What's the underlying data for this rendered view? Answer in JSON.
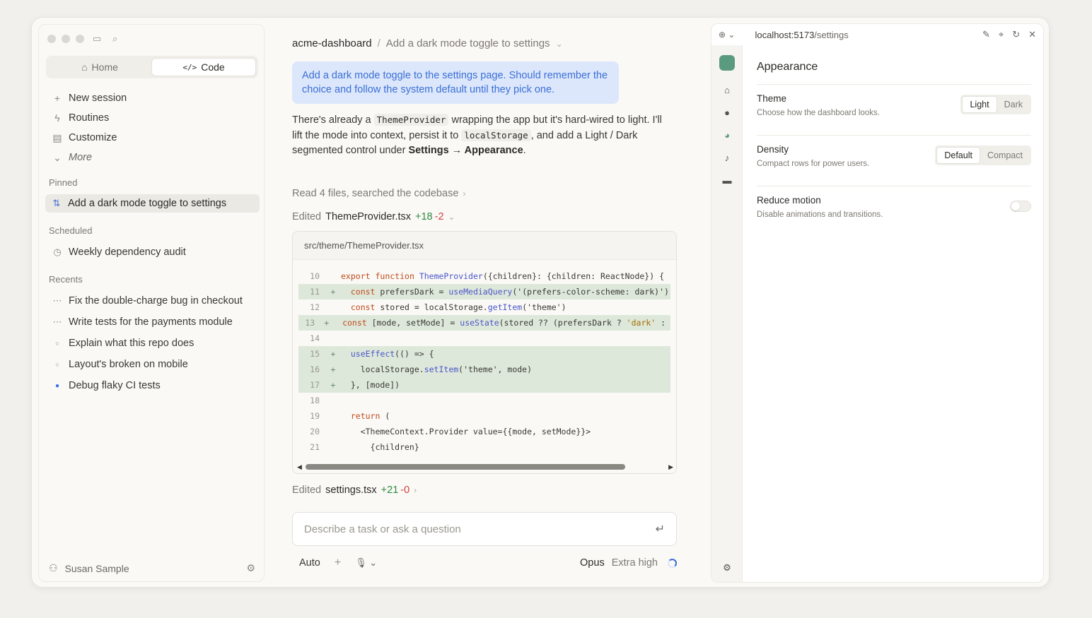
{
  "sidebar": {
    "segment": {
      "home_label": "Home",
      "code_label": "Code"
    },
    "nav": [
      {
        "label": "New session",
        "icon": "plus-icon"
      },
      {
        "label": "Routines",
        "icon": "lightning-icon"
      },
      {
        "label": "Customize",
        "icon": "box-icon"
      },
      {
        "label": "More",
        "icon": "chevron-down-icon"
      }
    ],
    "pinned_label": "Pinned",
    "pinned_item": "Add a dark mode toggle to settings",
    "scheduled_label": "Scheduled",
    "scheduled_item": "Weekly dependency audit",
    "recents_label": "Recents",
    "recents": [
      {
        "label": "Fix the double-charge bug in checkout"
      },
      {
        "label": "Write tests for the payments module"
      },
      {
        "label": "Explain what this repo does"
      },
      {
        "label": "Layout's broken on mobile"
      },
      {
        "label": "Debug flaky CI tests"
      }
    ],
    "user_name": "Susan Sample"
  },
  "main": {
    "repo": "acme-dashboard",
    "breadcrumb_sep": "/",
    "session_title": "Add a dark mode toggle to settings",
    "user_message": "Add a dark mode toggle to the settings page. Should remember the choice and follow the system default until they pick one.",
    "reply": {
      "p1": "There's already a ",
      "c1": "ThemeProvider",
      "p2": " wrapping the app but it's hard-wired to light. I'll lift the mode into context, persist it to ",
      "c2": "localStorage",
      "p3": ", and add a Light / Dark segmented control under ",
      "b1": "Settings → Appearance",
      "p4": "."
    },
    "activity_read": "Read 4 files, searched the codebase",
    "edit1": {
      "prefix": "Edited",
      "file": "ThemeProvider.tsx",
      "add": "+18",
      "del": "-2"
    },
    "code_file_path": "src/theme/ThemeProvider.tsx",
    "edit2": {
      "prefix": "Edited",
      "file": "settings.tsx",
      "add": "+21",
      "del": "-0"
    },
    "input_placeholder": "Describe a task or ask a question",
    "bottom": {
      "mode": "Auto",
      "model": "Opus",
      "effort": "Extra high"
    }
  },
  "browser": {
    "url_host": "localhost:5173",
    "url_path": "/settings",
    "heading": "Appearance",
    "theme": {
      "title": "Theme",
      "desc": "Choose how the dashboard looks.",
      "opt1": "Light",
      "opt2": "Dark",
      "selected": "Light"
    },
    "density": {
      "title": "Density",
      "desc": "Compact rows for power users.",
      "opt1": "Default",
      "opt2": "Compact",
      "selected": "Default"
    },
    "motion": {
      "title": "Reduce motion",
      "desc": "Disable animations and transitions.",
      "enabled": false
    }
  },
  "colors": {
    "accent_blue": "#3b6fd6",
    "added": "#2d8a3e",
    "removed": "#d0413e",
    "brand_green": "#5a9a7f"
  }
}
